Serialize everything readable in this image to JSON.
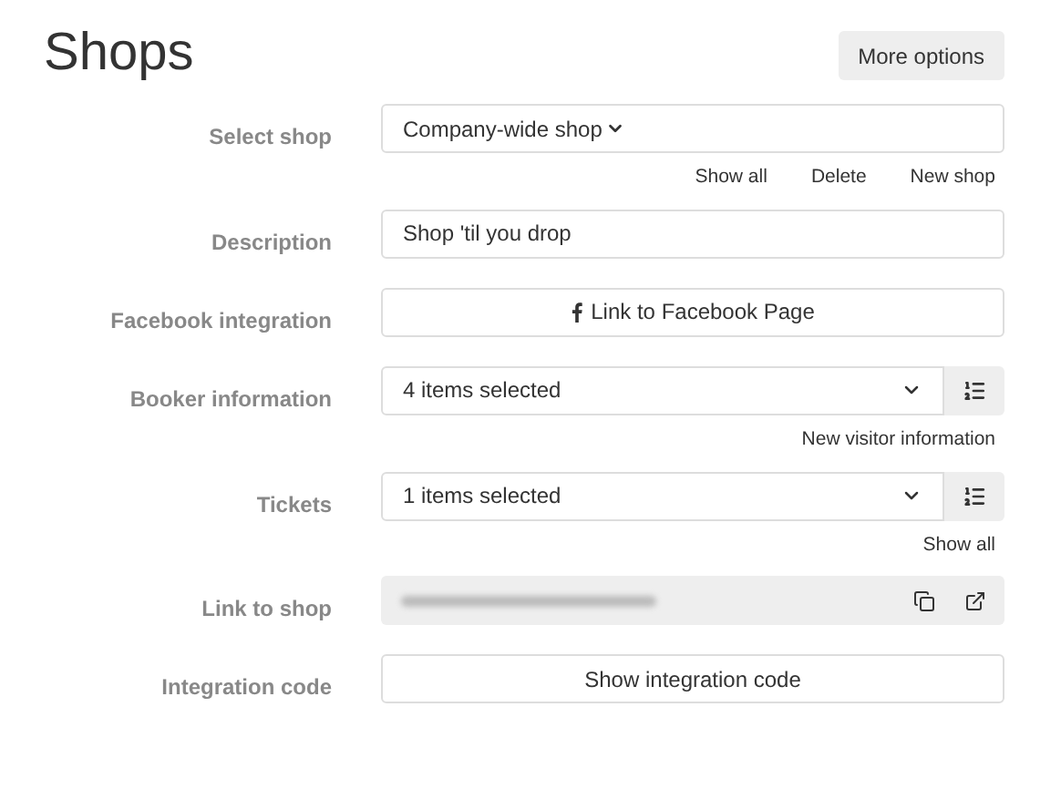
{
  "title": "Shops",
  "header_button": "More options",
  "rows": [
    {
      "kind": "dropdown",
      "label": "Select shop",
      "value": "Company-wide shop",
      "links": [
        "Show all",
        "Delete",
        "New shop"
      ]
    },
    {
      "kind": "text",
      "label": "Description",
      "value": "Shop 'til you drop"
    },
    {
      "kind": "facebook_button",
      "label": "Facebook integration",
      "value": "Link to Facebook Page"
    },
    {
      "kind": "multiselect",
      "label": "Booker information",
      "value": "4 items selected",
      "links": [
        "New visitor information"
      ]
    },
    {
      "kind": "multiselect",
      "label": "Tickets",
      "value": "1 items selected",
      "links": [
        "Show all"
      ]
    },
    {
      "kind": "link",
      "label": "Link to shop"
    },
    {
      "kind": "button",
      "label": "Integration code",
      "value": "Show integration code"
    }
  ]
}
